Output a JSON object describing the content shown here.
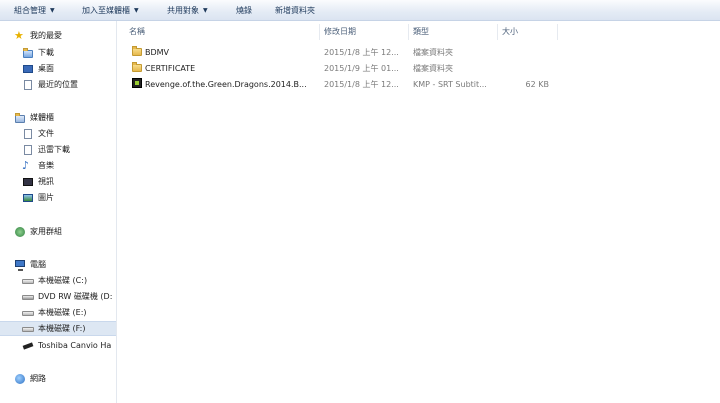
{
  "toolbar": {
    "organize": "組合管理",
    "add_to_library": "加入至媒體櫃",
    "share_with": "共用對象",
    "burn": "燒錄",
    "new_folder": "新增資料夾"
  },
  "sidebar": {
    "favorites": "我的最愛",
    "downloads": "下載",
    "desktop": "桌面",
    "recent_places": "最近的位置",
    "libraries": "媒體櫃",
    "documents": "文件",
    "thunder_downloads": "迅雷下載",
    "music": "音樂",
    "videos": "視訊",
    "pictures": "圖片",
    "homegroup": "家用群組",
    "computer": "電腦",
    "drive_c": "本機磁碟 (C:)",
    "drive_d": "DVD RW 磁碟機 (D:",
    "drive_e": "本機磁碟 (E:)",
    "drive_f": "本機磁碟 (F:)",
    "toshiba": "Toshiba Canvio Ha",
    "network": "網路"
  },
  "columns": {
    "name": "名稱",
    "modified": "修改日期",
    "type": "類型",
    "size": "大小"
  },
  "files": [
    {
      "name": "BDMV",
      "modified": "2015/1/8 上午 12...",
      "type": "檔案資料夾",
      "size": "",
      "icon": "folder-icon"
    },
    {
      "name": "CERTIFICATE",
      "modified": "2015/1/9 上午 01...",
      "type": "檔案資料夾",
      "size": "",
      "icon": "folder-icon"
    },
    {
      "name": "Revenge.of.the.Green.Dragons.2014.B...",
      "modified": "2015/1/8 上午 12...",
      "type": "KMP - SRT Subtit...",
      "size": "62 KB",
      "icon": "subtitle-file-icon"
    }
  ]
}
